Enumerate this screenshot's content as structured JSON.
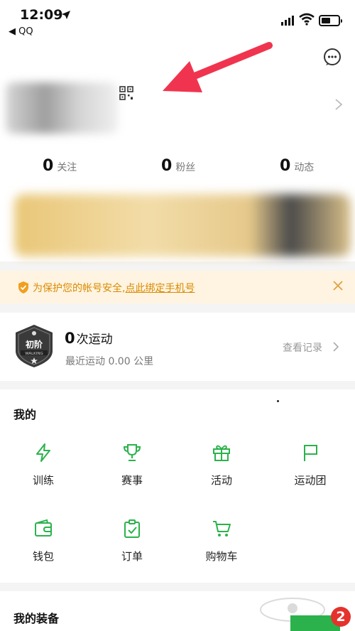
{
  "status_bar": {
    "time": "12:09",
    "back_app": "◀ QQ"
  },
  "profile": {
    "stats": [
      {
        "num": "0",
        "label": "关注"
      },
      {
        "num": "0",
        "label": "粉丝"
      },
      {
        "num": "0",
        "label": "动态"
      }
    ]
  },
  "notice": {
    "text": "为保护您的帐号安全,",
    "link": "点此绑定手机号"
  },
  "sport": {
    "badge_text": "初阶",
    "badge_sub": "WALKING",
    "count": "0",
    "unit": "次运动",
    "recent": "最近运动 0.00 公里",
    "view_record": "查看记录"
  },
  "mine": {
    "title": "我的",
    "items": [
      {
        "label": "训练",
        "icon": "lightning-icon"
      },
      {
        "label": "赛事",
        "icon": "trophy-icon"
      },
      {
        "label": "活动",
        "icon": "gift-icon"
      },
      {
        "label": "运动团",
        "icon": "flag-icon"
      },
      {
        "label": "钱包",
        "icon": "wallet-icon"
      },
      {
        "label": "订单",
        "icon": "clipboard-check-icon"
      },
      {
        "label": "购物车",
        "icon": "cart-icon"
      }
    ]
  },
  "equip": {
    "title": "我的装备",
    "badge": "2"
  },
  "colors": {
    "accent_green": "#2bb24c",
    "notice_orange": "#d98a00",
    "annotation_red": "#f0344f"
  }
}
